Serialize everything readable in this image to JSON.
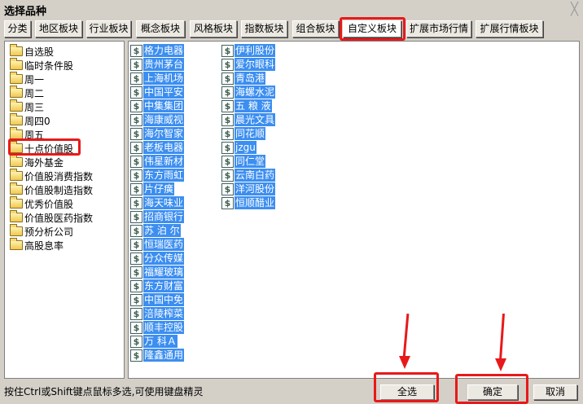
{
  "window": {
    "title": "选择品种",
    "close_icon": "close-icon"
  },
  "tabs": [
    {
      "label": "分类"
    },
    {
      "label": "地区板块"
    },
    {
      "label": "行业板块"
    },
    {
      "label": "概念板块"
    },
    {
      "label": "风格板块"
    },
    {
      "label": "指数板块"
    },
    {
      "label": "组合板块"
    },
    {
      "label": "自定义板块",
      "active": true
    },
    {
      "label": "扩展市场行情"
    },
    {
      "label": "扩展行情板块"
    }
  ],
  "blocks": [
    {
      "label": "自选股"
    },
    {
      "label": "临时条件股"
    },
    {
      "label": "周一"
    },
    {
      "label": "周二"
    },
    {
      "label": "周三"
    },
    {
      "label": "周四0"
    },
    {
      "label": "周五"
    },
    {
      "label": "十点价值股",
      "selected": true
    },
    {
      "label": "海外基金"
    },
    {
      "label": "价值股消费指数"
    },
    {
      "label": "价值股制造指数"
    },
    {
      "label": "优秀价值股"
    },
    {
      "label": "价值股医药指数"
    },
    {
      "label": "预分析公司"
    },
    {
      "label": "高股息率"
    }
  ],
  "stocks_col1": [
    "格力电器",
    "贵州茅台",
    "上海机场",
    "中国平安",
    "中集集团",
    "海康威视",
    "海尔智家",
    "老板电器",
    "伟星新材",
    "东方雨虹",
    "片仔癀",
    "海天味业",
    "招商银行",
    "苏 泊 尔",
    "恒瑞医药",
    "分众传媒",
    "福耀玻璃",
    "东方财富",
    "中国中免",
    "涪陵榨菜",
    "顺丰控股",
    "万 科Ａ",
    "隆鑫通用"
  ],
  "stocks_col2": [
    "伊利股份",
    "爱尔眼科",
    "青岛港",
    "海螺水泥",
    "五 粮 液",
    "晨光文具",
    "同花顺",
    "jzgu",
    "同仁堂",
    "云南白药",
    "洋河股份",
    "恒顺醋业"
  ],
  "stock_icon_glyph": "$",
  "footer": {
    "hint": "按住Ctrl或Shift键点鼠标多选,可使用键盘精灵",
    "select_all": "全选",
    "ok": "确定",
    "cancel": "取消"
  },
  "colors": {
    "selection": "#3c8ef0",
    "annotation": "#e8191a"
  }
}
